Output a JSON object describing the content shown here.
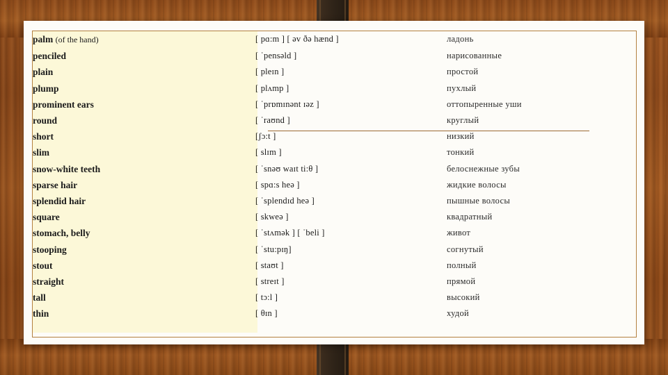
{
  "slide": {
    "background_color": "#fdfcf8",
    "highlight_color": "#fcf8d8",
    "wood_color": "#96521e",
    "strap_color": "#2e2318",
    "border_color": "#b3803f",
    "divider_color": "#9b6a33"
  },
  "table": {
    "rows": [
      {
        "english": "palm ",
        "english_paren": "(of the hand)",
        "ipa": "[ pɑ:m ] [ əv ðə hænd ]",
        "russian": "ладонь"
      },
      {
        "english": "penciled",
        "english_paren": "",
        "ipa": "[ ˈpensəld ]",
        "russian": "нарисованные"
      },
      {
        "english": "plain",
        "english_paren": "",
        "ipa": "[ pleɪn ]",
        "russian": "простой"
      },
      {
        "english": "plump",
        "english_paren": "",
        "ipa": "[ plʌmp ]",
        "russian": "пухлый"
      },
      {
        "english": "prominent ears",
        "english_paren": "",
        "ipa": "[ ˈprɒmɪnənt ɪəz ]",
        "russian": "оттопыренные уши"
      },
      {
        "english": "round",
        "english_paren": "",
        "ipa": "[ ˈraʊnd ]",
        "russian": "круглый"
      },
      {
        "english": "short",
        "english_paren": "",
        "ipa": "[ʃɔ:t ]",
        "russian": "низкий"
      },
      {
        "english": "slim",
        "english_paren": "",
        "ipa": "[ slɪm ]",
        "russian": "тонкий"
      },
      {
        "english": "snow-white teeth",
        "english_paren": "",
        "ipa": "[ ˈsnəʊ waɪt ti:θ ]",
        "russian": "белоснежные зубы"
      },
      {
        "english": "sparse hair",
        "english_paren": "",
        "ipa": "[ spɑ:s heə ]",
        "russian": "жидкие волосы"
      },
      {
        "english": "splendid hair",
        "english_paren": "",
        "ipa": "[ ˈsplendɪd heə ]",
        "russian": "пышные волосы"
      },
      {
        "english": "square",
        "english_paren": "",
        "ipa": "[ skweə ]",
        "russian": "квадратный"
      },
      {
        "english": "stomach, belly",
        "english_paren": "",
        "ipa": "[ ˈstʌmək ] [ ˈbeli ]",
        "russian": "живот"
      },
      {
        "english": "stooping",
        "english_paren": "",
        "ipa": "[ ˈstu:pɪŋ]",
        "russian": "согнутый"
      },
      {
        "english": "stout",
        "english_paren": "",
        "ipa": "[ staʊt ]",
        "russian": "полный"
      },
      {
        "english": "straight",
        "english_paren": "",
        "ipa": "[ streɪt ]",
        "russian": "прямой"
      },
      {
        "english": "tall",
        "english_paren": "",
        "ipa": "[ tɔ:l ]",
        "russian": "высокий"
      },
      {
        "english": "thin",
        "english_paren": "",
        "ipa": "[ θɪn ]",
        "russian": "худой"
      }
    ]
  }
}
